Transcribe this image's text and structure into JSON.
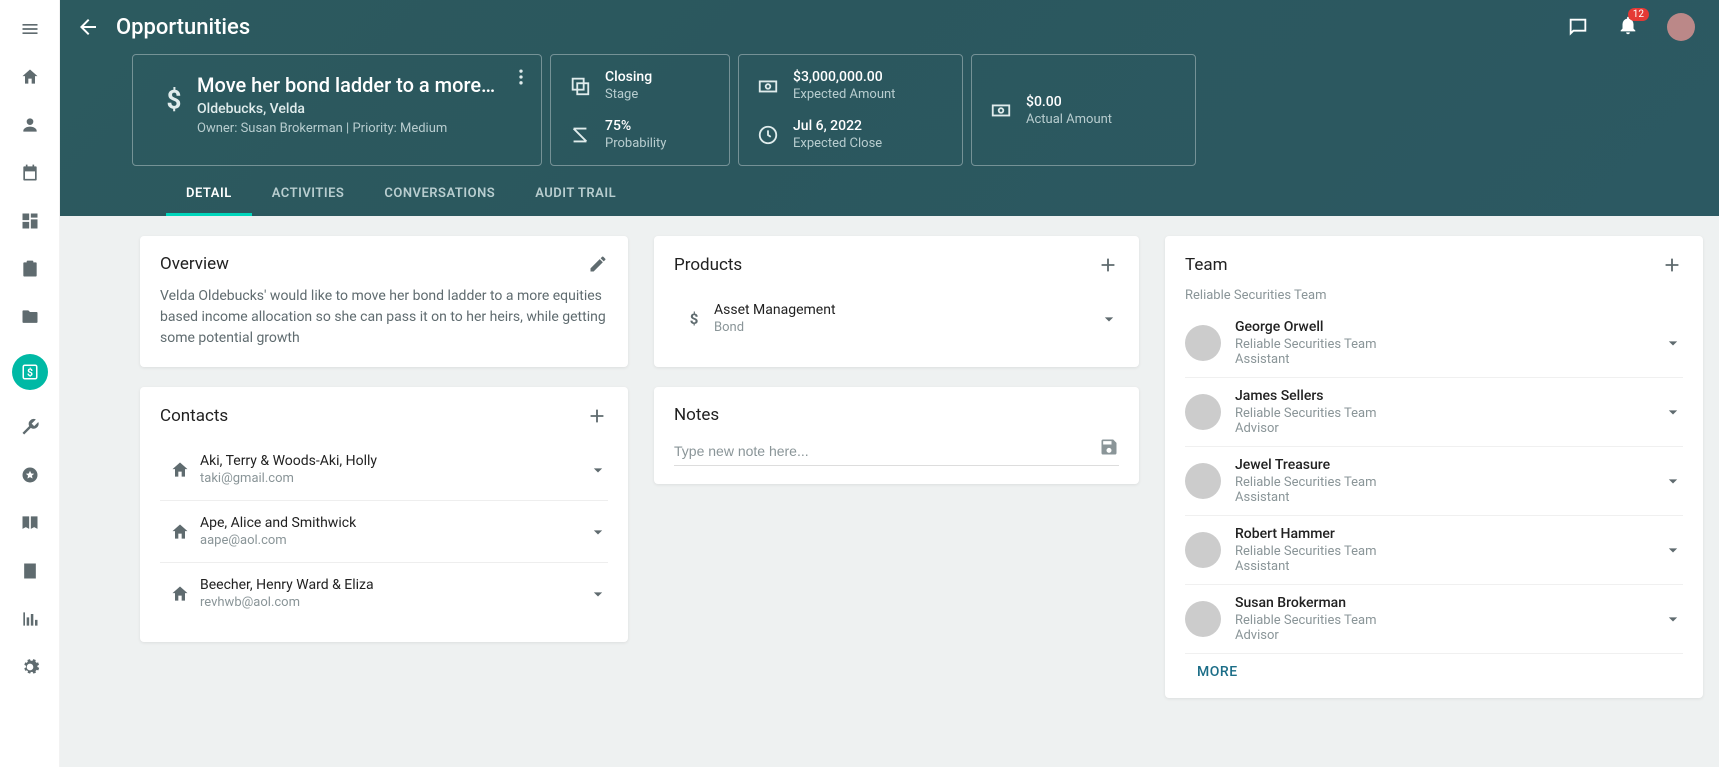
{
  "header": {
    "title": "Opportunities",
    "notif_count": "12",
    "record_title": "Move her bond ladder to a more…",
    "record_contact": "Oldebucks, Velda",
    "record_meta": "Owner: Susan Brokerman | Priority: Medium",
    "stats": {
      "stage_val": "Closing",
      "stage_lbl": "Stage",
      "prob_val": "75%",
      "prob_lbl": "Probability",
      "exp_amt_val": "$3,000,000.00",
      "exp_amt_lbl": "Expected Amount",
      "exp_close_val": "Jul 6, 2022",
      "exp_close_lbl": "Expected Close",
      "act_amt_val": "$0.00",
      "act_amt_lbl": "Actual Amount"
    }
  },
  "tabs": [
    "DETAIL",
    "ACTIVITIES",
    "CONVERSATIONS",
    "AUDIT TRAIL"
  ],
  "overview": {
    "title": "Overview",
    "body": "Velda Oldebucks' would like to move her bond ladder to a more equities based income allocation so she can pass it on to her heirs, while getting some potential growth"
  },
  "contacts": {
    "title": "Contacts",
    "items": [
      {
        "name": "Aki, Terry & Woods-Aki, Holly",
        "email": "taki@gmail.com"
      },
      {
        "name": "Ape, Alice and Smithwick",
        "email": "aape@aol.com"
      },
      {
        "name": "Beecher, Henry Ward & Eliza",
        "email": "revhwb@aol.com"
      }
    ]
  },
  "products": {
    "title": "Products",
    "items": [
      {
        "name": "Asset Management",
        "type": "Bond"
      }
    ]
  },
  "notes": {
    "title": "Notes",
    "placeholder": "Type new note here..."
  },
  "team": {
    "title": "Team",
    "sub": "Reliable Securities Team",
    "more": "MORE",
    "members": [
      {
        "name": "George Orwell",
        "org": "Reliable Securities Team",
        "role": "Assistant"
      },
      {
        "name": "James Sellers",
        "org": "Reliable Securities Team",
        "role": "Advisor"
      },
      {
        "name": "Jewel Treasure",
        "org": "Reliable Securities Team",
        "role": "Assistant"
      },
      {
        "name": "Robert Hammer",
        "org": "Reliable Securities Team",
        "role": "Assistant"
      },
      {
        "name": "Susan Brokerman",
        "org": "Reliable Securities Team",
        "role": "Advisor"
      }
    ]
  }
}
